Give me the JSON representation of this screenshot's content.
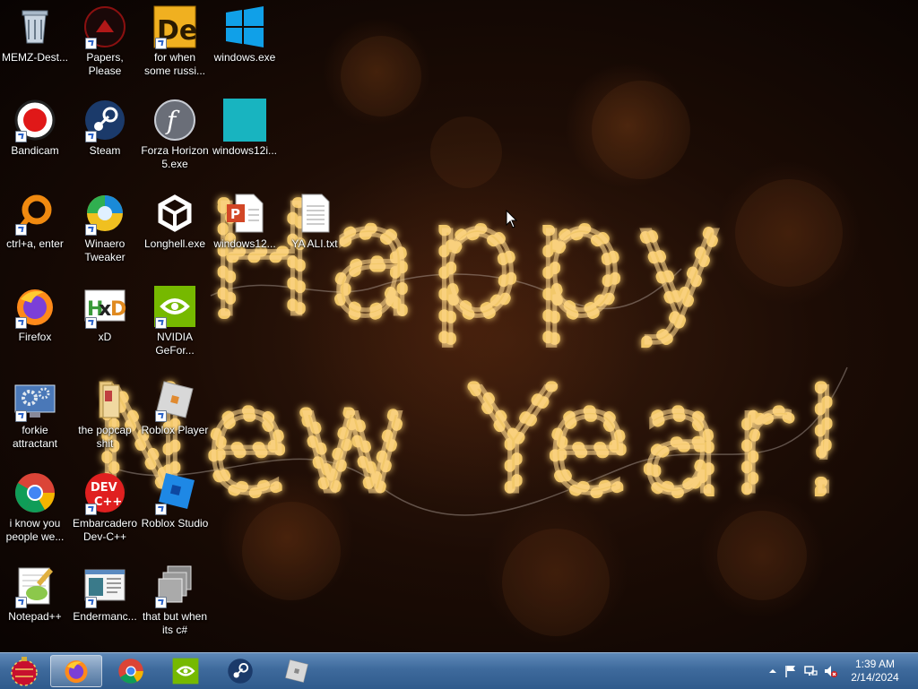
{
  "wallpaper": {
    "line1": "Happy",
    "line2": "New Year!"
  },
  "desktop_icons": [
    {
      "label": "MEMZ-Dest...",
      "icon": "recycle-bin-icon"
    },
    {
      "label": "Papers, Please",
      "icon": "papers-please-icon"
    },
    {
      "label": "for when some russi...",
      "icon": "de-app-icon"
    },
    {
      "label": "windows.exe",
      "icon": "windows-logo-icon"
    },
    {
      "label": "Bandicam",
      "icon": "bandicam-icon"
    },
    {
      "label": "Steam",
      "icon": "steam-icon"
    },
    {
      "label": "Forza Horizon 5.exe",
      "icon": "flash-icon"
    },
    {
      "label": "windows12i...",
      "icon": "teal-square-icon"
    },
    {
      "label": "ctrl+a, enter",
      "icon": "orange-ring-icon"
    },
    {
      "label": "Winaero Tweaker",
      "icon": "winaero-icon"
    },
    {
      "label": "Longhell.exe",
      "icon": "unity-icon"
    },
    {
      "label": "windows12...",
      "icon": "powerpoint-icon"
    },
    {
      "label": "YA ALI.txt",
      "icon": "text-file-icon"
    },
    {
      "label": "Firefox",
      "icon": "firefox-icon"
    },
    {
      "label": "xD",
      "icon": "hxd-icon"
    },
    {
      "label": "NVIDIA GeFor...",
      "icon": "nvidia-icon"
    },
    {
      "label": "forkie attractant",
      "icon": "control-panel-icon"
    },
    {
      "label": "the popcap shit",
      "icon": "folder-icon"
    },
    {
      "label": "Roblox Player",
      "icon": "roblox-player-icon"
    },
    {
      "label": "i know you people we...",
      "icon": "chrome-icon"
    },
    {
      "label": "Embarcadero Dev-C++",
      "icon": "devcpp-icon"
    },
    {
      "label": "Roblox Studio",
      "icon": "roblox-studio-icon"
    },
    {
      "label": "Notepad++",
      "icon": "notepadpp-icon"
    },
    {
      "label": "Endermanc...",
      "icon": "endermanch-icon"
    },
    {
      "label": "that but when its c#",
      "icon": "stack-icon"
    }
  ],
  "taskbar": {
    "start": "start-orb-icon",
    "pinned": [
      "firefox-icon",
      "chrome-icon",
      "nvidia-icon",
      "steam-icon",
      "roblox-player-icon"
    ]
  },
  "tray": {
    "time": "1:39 AM",
    "date": "2/14/2024"
  },
  "colors": {
    "taskbar": "#3e6a9c",
    "lights": "#ffd070"
  }
}
